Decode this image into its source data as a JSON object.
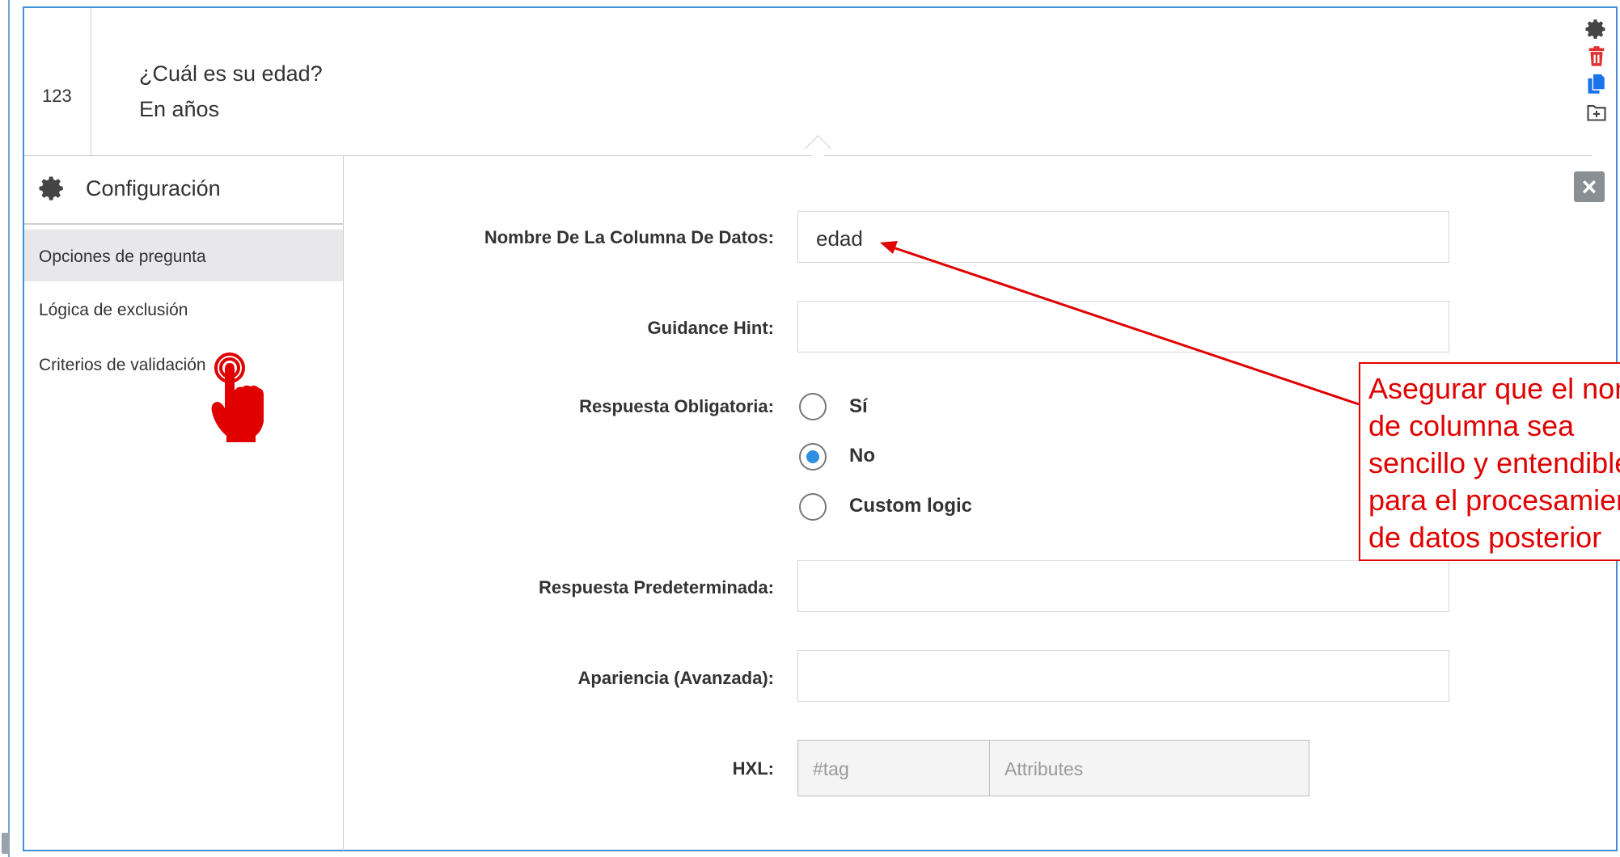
{
  "question": {
    "number": "123",
    "title": "¿Cuál es su edad?",
    "subtitle": "En años"
  },
  "toolbar": {
    "icons": [
      "gear-icon",
      "trash-icon",
      "copy-icon",
      "add-to-library-icon"
    ],
    "close_label": "×"
  },
  "sidebar": {
    "header": "Configuración",
    "items": [
      {
        "label": "Opciones de pregunta",
        "active": true
      },
      {
        "label": "Lógica de exclusión",
        "active": false
      },
      {
        "label": "Criterios de validación",
        "active": false
      }
    ]
  },
  "form": {
    "data_column_name": {
      "label": "Nombre De La Columna De Datos:",
      "value": "edad"
    },
    "guidance_hint": {
      "label": "Guidance Hint:",
      "value": ""
    },
    "required": {
      "label": "Respuesta Obligatoria:",
      "options": [
        {
          "label": "Sí",
          "checked": false
        },
        {
          "label": "No",
          "checked": true
        },
        {
          "label": "Custom logic",
          "checked": false
        }
      ]
    },
    "default_response": {
      "label": "Respuesta Predeterminada:",
      "value": ""
    },
    "appearance": {
      "label": "Apariencia (Avanzada):",
      "value": ""
    },
    "hxl": {
      "label": "HXL:",
      "tag_placeholder": "#tag",
      "attributes_placeholder": "Attributes"
    }
  },
  "annotation": {
    "lines": [
      "Asegurar que el nombre",
      "de columna sea",
      "sencillo y entendible",
      "para el procesamiento",
      "de datos posterior"
    ],
    "color": "#e00000"
  },
  "colors": {
    "accent": "#2f8fe0",
    "frame": "#3d8fd6",
    "delete": "#e03030"
  }
}
